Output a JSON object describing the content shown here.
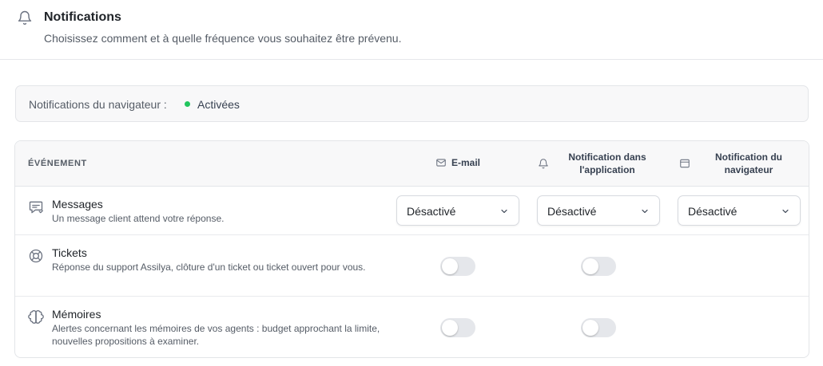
{
  "header": {
    "title": "Notifications",
    "subtitle": "Choisissez comment et à quelle fréquence vous souhaitez être prévenu."
  },
  "browser_status": {
    "label": "Notifications du navigateur :",
    "value": "Activées",
    "status_color": "#22c55e"
  },
  "table": {
    "columns": {
      "event": "ÉVÉNEMENT",
      "email": "E-mail",
      "in_app": "Notification dans l'application",
      "browser": "Notification du navigateur"
    },
    "rows": [
      {
        "title": "Messages",
        "description": "Un message client attend votre réponse.",
        "icon": "message-icon",
        "email": "Désactivé",
        "in_app": "Désactivé",
        "browser": "Désactivé"
      },
      {
        "title": "Tickets",
        "description": "Réponse du support Assilya, clôture d'un ticket ou ticket ouvert pour vous.",
        "icon": "lifebuoy-icon",
        "email_enabled": false,
        "in_app_enabled": false
      },
      {
        "title": "Mémoires",
        "description": "Alertes concernant les mémoires de vos agents : budget approchant la limite, nouvelles propositions à examiner.",
        "icon": "brain-icon",
        "email_enabled": false,
        "in_app_enabled": false
      }
    ]
  }
}
